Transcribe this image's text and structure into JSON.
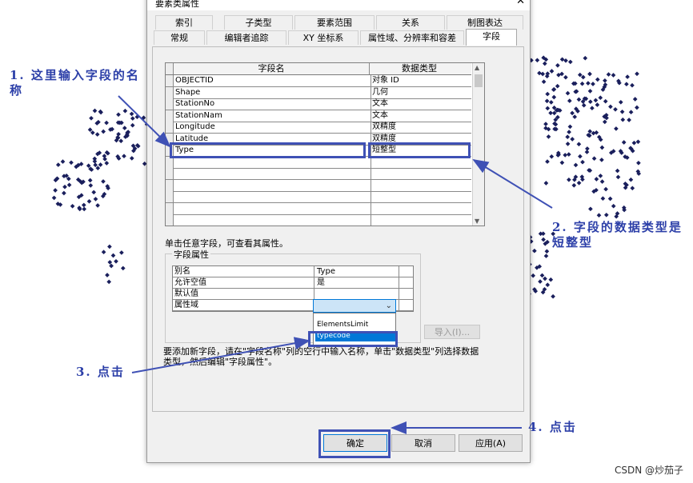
{
  "dialog": {
    "title": "要素类属性",
    "tabs_row1": [
      "索引",
      "子类型",
      "要素范围",
      "关系",
      "制图表达"
    ],
    "tabs_row2": [
      "常规",
      "编辑者追踪",
      "XY 坐标系",
      "属性域、分辨率和容差",
      "字段"
    ],
    "active_tab": "字段"
  },
  "fields_grid": {
    "headers": {
      "name": "字段名",
      "type": "数据类型"
    },
    "rows": [
      {
        "name": "OBJECTID",
        "type": "对象 ID"
      },
      {
        "name": "Shape",
        "type": "几何"
      },
      {
        "name": "StationNo",
        "type": "文本"
      },
      {
        "name": "StationNam",
        "type": "文本"
      },
      {
        "name": "Longitude",
        "type": "双精度"
      },
      {
        "name": "Latitude",
        "type": "双精度"
      },
      {
        "name": "Type",
        "type": "短整型"
      }
    ]
  },
  "hint": "单击任意字段，可查看其属性。",
  "field_props": {
    "group_label": "字段属性",
    "rows": [
      {
        "name": "别名",
        "value": "Type"
      },
      {
        "name": "允许空值",
        "value": "是"
      },
      {
        "name": "默认值",
        "value": ""
      },
      {
        "name": "属性域",
        "value": ""
      }
    ],
    "dropdown_options": [
      "ElementsLimit",
      "typecode"
    ],
    "selected_option": "typecode"
  },
  "import_button": "导入(I)...",
  "info_text": "要添加新字段，请在\"字段名称\"列的空行中输入名称，单击\"数据类型\"列选择数据类型，然后编辑\"字段属性\"。",
  "buttons": {
    "ok": "确定",
    "cancel": "取消",
    "apply": "应用(A)"
  },
  "annotations": {
    "a1": "1. 这里输入字段的名称",
    "a2": "2. 字段的数据类型是短整型",
    "a3": "3. 点击",
    "a4": "4. 点击"
  },
  "watermark": "CSDN @炒茄子",
  "colors": {
    "annotation": "#3f51b5",
    "selection": "#0078d7"
  }
}
